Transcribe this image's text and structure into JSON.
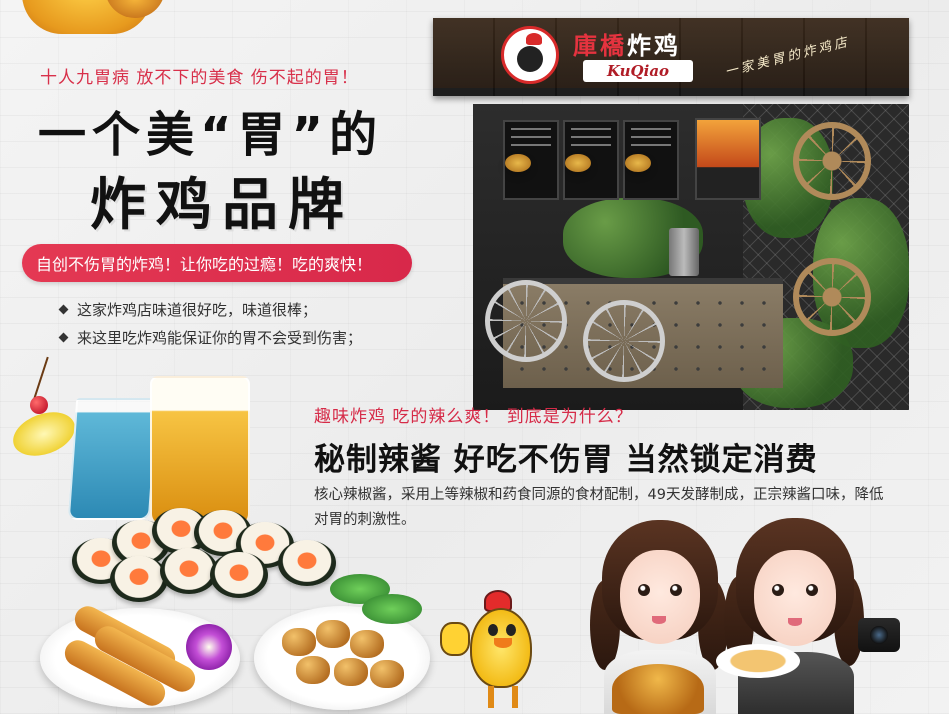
{
  "left_block": {
    "tagline": "十人九胃病 放不下的美食 伤不起的胃！",
    "title_line1": "一个美“胃”的",
    "title_line2": "炸鸡品牌",
    "pill_text": "自创不伤胃的炸鸡！让你吃的过瘾！吃的爽快！",
    "bullets": [
      "这家炸鸡店味道很好吃，味道很棒；",
      "来这里吃炸鸡能保证你的胃不会受到伤害；"
    ]
  },
  "kiosk_sign": {
    "brand_cn_red": "庫橋",
    "brand_cn_white": "炸鸡",
    "brand_en": "KuQiao",
    "slogan": "一家美胃的炸鸡店"
  },
  "feature_block": {
    "fun_text": "趣味炸鸡  吃的辣么爽！  到底是为什么？",
    "headline": "秘制辣酱 好吃不伤胃 当然锁定消费",
    "description": "核心辣椒酱，采用上等辣椒和药食同源的食材配制，49天发酵制成，正宗辣酱口味，降低对胃的刺激性。"
  },
  "colors": {
    "accent_red": "#d8284a",
    "title_black": "#111111",
    "kiosk_dark": "#22170f"
  }
}
